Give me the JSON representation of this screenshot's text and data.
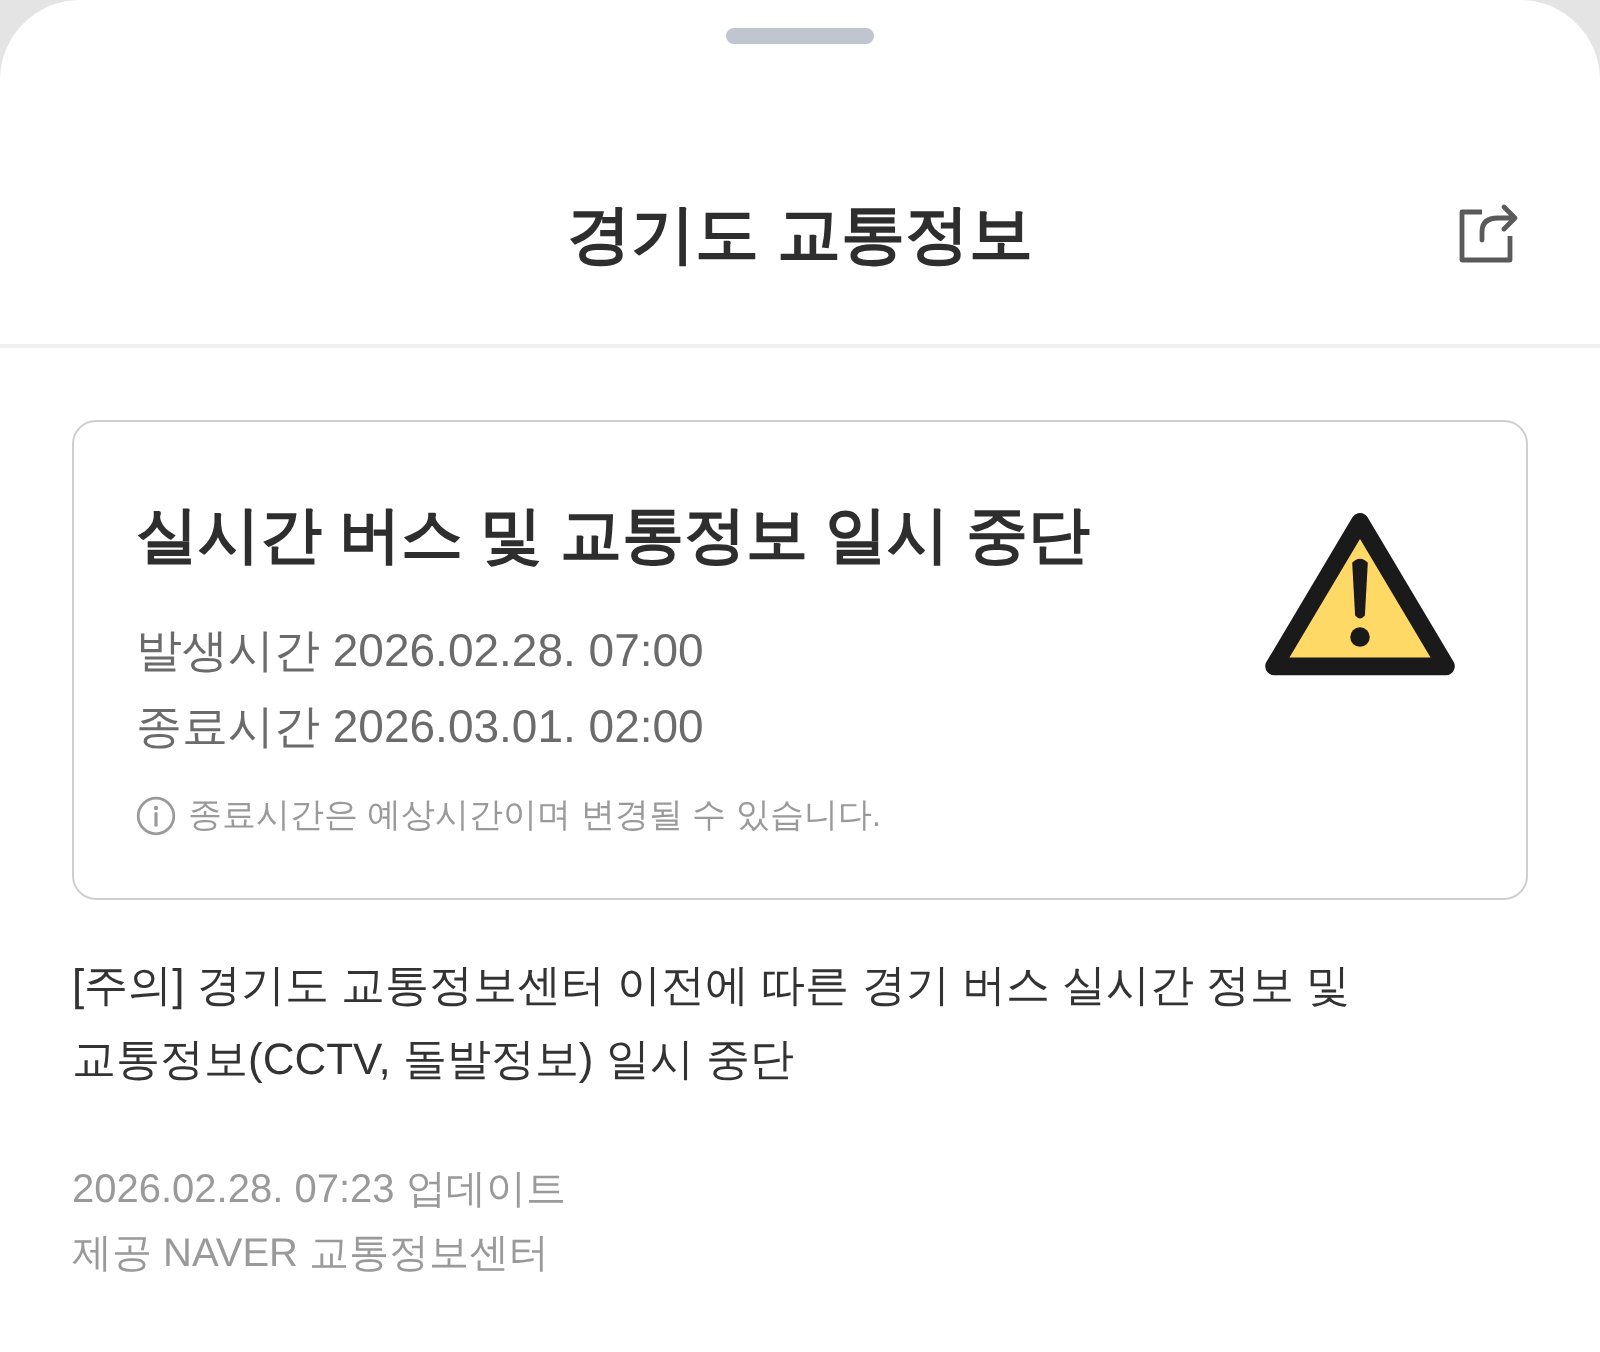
{
  "header": {
    "title": "경기도 교통정보"
  },
  "alert": {
    "title": "실시간 버스 및 교통정보 일시 중단",
    "times": [
      "발생시간 2026.02.28. 07:00",
      "종료시간 2026.03.01. 02:00"
    ],
    "note": "종료시간은 예상시간이며 변경될 수 있습니다."
  },
  "notice": "[주의] 경기도 교통정보센터 이전에 따른 경기 버스 실시간 정보 및 교통정보(CCTV, 돌발정보) 일시 중단",
  "updated": "2026.02.28. 07:23 업데이트",
  "source": "제공 NAVER 교통정보센터"
}
